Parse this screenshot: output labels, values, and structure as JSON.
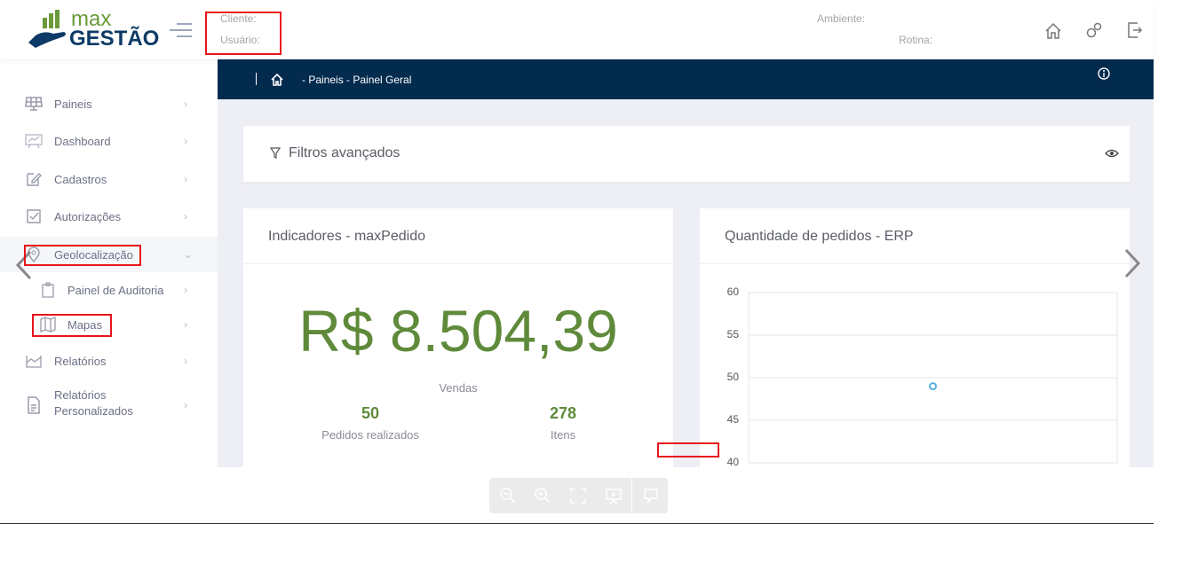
{
  "header": {
    "logo_top": "max",
    "logo_bottom": "GESTÃO",
    "cliente_label": "Cliente:",
    "usuario_label": "Usuário:",
    "ambiente_label": "Ambiente:",
    "rotina_label": "Rotina:",
    "icons": [
      "home-icon",
      "gears-icon",
      "logout-icon"
    ]
  },
  "breadcrumb": {
    "path": "- Paineis - Painel Geral",
    "icons": [
      "home-icon",
      "info-icon"
    ]
  },
  "sidebar": {
    "items": [
      {
        "label": "Paineis",
        "icon": "solar-panel-icon"
      },
      {
        "label": "Dashboard",
        "icon": "presentation-chart-icon"
      },
      {
        "label": "Cadastros",
        "icon": "edit-icon"
      },
      {
        "label": "Autorizações",
        "icon": "checkbox-icon"
      },
      {
        "label": "Geolocalização",
        "icon": "map-pin-icon",
        "expanded": true
      },
      {
        "label": "Painel de Auditoria",
        "icon": "clipboard-icon"
      },
      {
        "label": "Mapas",
        "icon": "map-icon"
      },
      {
        "label": "Relatórios",
        "icon": "report-chart-icon"
      },
      {
        "label": "Relatórios",
        "label2": "Personalizados",
        "icon": "document-icon"
      }
    ]
  },
  "filters": {
    "label": "Filtros avançados"
  },
  "indicators": {
    "title": "Indicadores - maxPedido",
    "sales_value": "R$ 8.504,39",
    "sales_label": "Vendas",
    "orders_value": "50",
    "orders_label": "Pedidos realizados",
    "items_value": "278",
    "items_label": "Itens",
    "accent": "#5f8a3a"
  },
  "chart_data": {
    "type": "scatter",
    "title": "Quantidade de pedidos - ERP",
    "ylim": [
      40,
      60
    ],
    "yticks": [
      "60",
      "55",
      "50",
      "45",
      "40"
    ],
    "grid": true,
    "points": [
      {
        "y": 49
      }
    ],
    "color": "#5ab0e0"
  },
  "toolbar": {
    "icons": [
      "zoom-out-icon",
      "zoom-in-icon",
      "fullscreen-icon",
      "present-icon",
      "comment-icon"
    ]
  },
  "colors": {
    "navy": "#032b4e",
    "green": "#5f8a3a"
  }
}
